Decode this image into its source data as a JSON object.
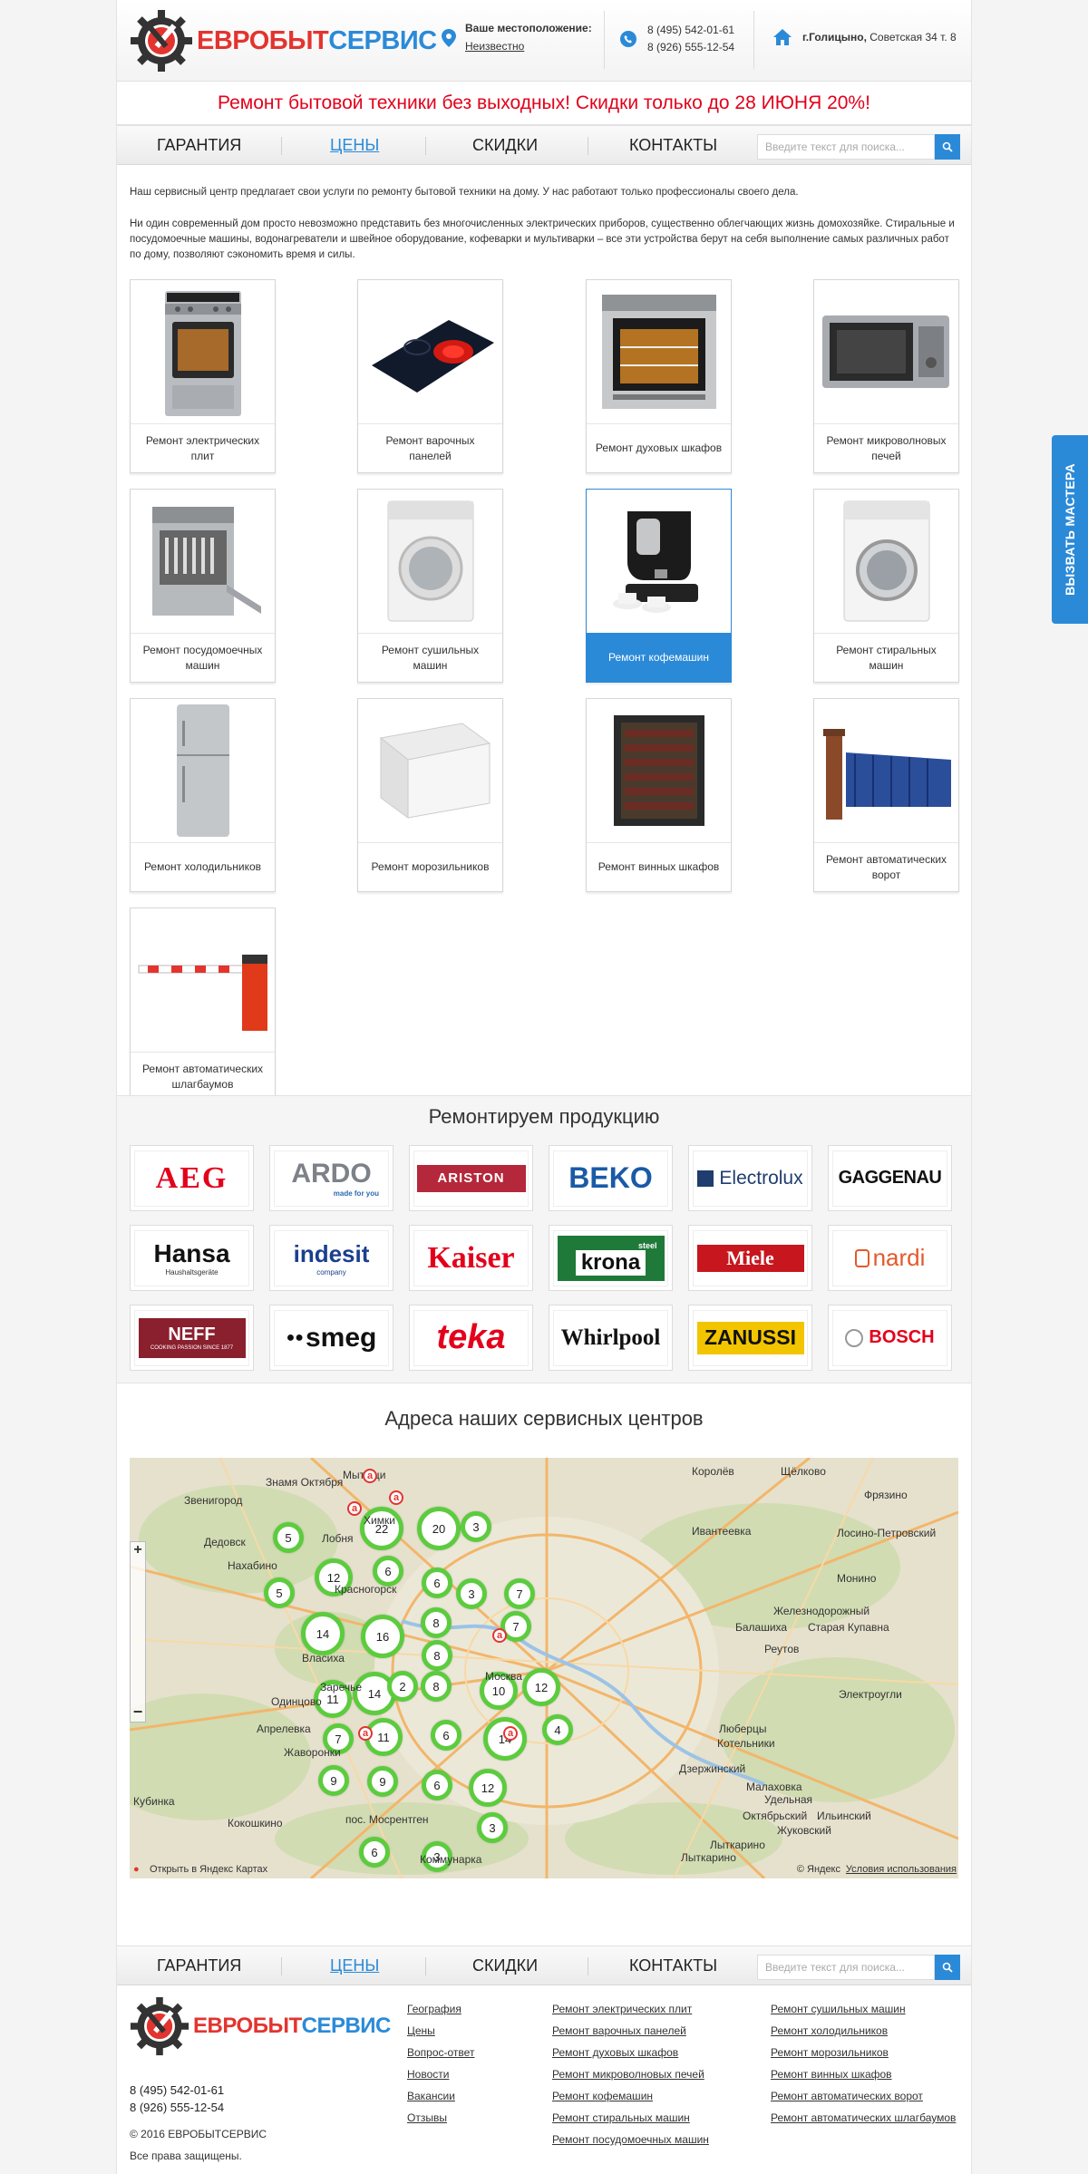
{
  "header": {
    "logo_red": "ЕВРОБЫТ",
    "logo_blue": "СЕРВИС",
    "location_title": "Ваше местоположение:",
    "location_value": "Неизвестно",
    "phone1": "8 (495) 542-01-61",
    "phone2": "8 (926) 555-12-54",
    "address_city": "г.Голицыно,",
    "address_street": " Советская 34 т. 8"
  },
  "promo": "Ремонт бытовой техники без выходных! Скидки только до 28 ИЮНЯ 20%!",
  "nav": {
    "items": [
      "ГАРАНТИЯ",
      "ЦЕНЫ",
      "СКИДКИ",
      "КОНТАКТЫ"
    ],
    "search_placeholder": "Введите текст для поиска..."
  },
  "intro": {
    "p1": "Наш сервисный центр предлагает свои услуги по ремонту бытовой техники на дому. У нас работают только профессионалы своего дела.",
    "p2": "Ни один современный дом просто невозможно представить без многочисленных электрических приборов, существенно облегчающих жизнь домохозяйке. Стиральные и посудомоечные машины, водонагреватели и швейное оборудование, кофеварки и мультиварки – все эти устройства берут на себя выполнение самых различных работ по дому, позволяют сэкономить время и силы."
  },
  "services": [
    {
      "label": "Ремонт электрических плит",
      "icon": "electric-stove"
    },
    {
      "label": "Ремонт варочных панелей",
      "icon": "cooktop"
    },
    {
      "label": "Ремонт духовых шкафов",
      "icon": "oven"
    },
    {
      "label": "Ремонт микроволновых печей",
      "icon": "microwave"
    },
    {
      "label": "Ремонт посудомоечных машин",
      "icon": "dishwasher"
    },
    {
      "label": "Ремонт сушильных машин",
      "icon": "dryer"
    },
    {
      "label": "Ремонт кофемашин",
      "icon": "coffee-machine"
    },
    {
      "label": "Ремонт стиральных машин",
      "icon": "washing-machine"
    },
    {
      "label": "Ремонт холодильников",
      "icon": "fridge"
    },
    {
      "label": "Ремонт морозильников",
      "icon": "freezer"
    },
    {
      "label": "Ремонт винных шкафов",
      "icon": "wine-cabinet"
    },
    {
      "label": "Ремонт автоматических ворот",
      "icon": "gate"
    },
    {
      "label": "Ремонт автоматических шлагбаумов",
      "icon": "barrier"
    }
  ],
  "brands_title": "Ремонтируем продукцию",
  "brands": [
    "AEG",
    "ARDO",
    "ARISTON",
    "BEKO",
    "Electrolux",
    "GAGGENAU",
    "Hansa",
    "indesit",
    "Kaiser",
    "krona",
    "Miele",
    "nardi",
    "NEFF",
    "smeg",
    "teka",
    "Whirlpool",
    "ZANUSSI",
    "BOSCH"
  ],
  "brand_sublines": {
    "ARDO": "made for you",
    "Hansa": "Haushaltsgeräte",
    "indesit": "company",
    "krona": "steel",
    "NEFF": "COOKING PASSION SINCE 1877"
  },
  "map": {
    "title": "Адреса наших сервисных центров",
    "clusters": [
      5,
      22,
      20,
      3,
      12,
      6,
      6,
      3,
      7,
      5,
      8,
      7,
      14,
      16,
      8,
      14,
      11,
      2,
      8,
      10,
      12,
      7,
      11,
      6,
      14,
      4,
      9,
      9,
      6,
      12,
      3,
      6,
      3
    ],
    "place_labels": [
      "Королёв",
      "Щёлково",
      "Мытищи",
      "Дедовск",
      "Нахабино",
      "Красногорск",
      "Балашиха",
      "Реутов",
      "Москва",
      "Одинцово",
      "Котельники",
      "Дзержинский",
      "Лыткарино",
      "Жуковский",
      "Люберцы",
      "Малаховка",
      "Старая Купавна",
      "Лосино-Петровский",
      "Монино",
      "Электроугли",
      "Ильинский",
      "Октябрьский",
      "Заречье",
      "Кокошкино",
      "Коммунарка",
      "пос. Мосрентген",
      "Звенигород",
      "Химки",
      "Железнодорожный",
      "Фрязино",
      "Лобня",
      "Ивантеевка",
      "Апрелевка",
      "Удельная",
      "Кубинка",
      "Жаворонки",
      "Власиха",
      "Знамя Октября",
      "Лыткарино"
    ],
    "open_link": "Открыть в Яндекс Картах",
    "copyright": "© Яндекс",
    "terms": "Условия использования"
  },
  "footer": {
    "nav_items": [
      "ГАРАНТИЯ",
      "ЦЕНЫ",
      "СКИДКИ",
      "КОНТАКТЫ"
    ],
    "search_placeholder": "Введите текст для поиска...",
    "phone1": "8 (495) 542-01-61",
    "phone2": "8 (926) 555-12-54",
    "copyright": "© 2016 ЕВРОБЫТСЕРВИС",
    "rights": "Все права защищены.",
    "col1": [
      "География",
      "Цены",
      "Вопрос-ответ",
      "Новости",
      "Вакансии",
      "Отзывы"
    ],
    "col2": [
      "Ремонт электрических плит",
      "Ремонт варочных панелей",
      "Ремонт духовых шкафов",
      "Ремонт микроволновых печей",
      "Ремонт кофемашин",
      "Ремонт стиральных машин",
      "Ремонт посудомоечных машин"
    ],
    "col3": [
      "Ремонт сушильных машин",
      "Ремонт холодильников",
      "Ремонт морозильников",
      "Ремонт винных шкафов",
      "Ремонт автоматических ворот",
      "Ремонт автоматических шлагбаумов"
    ]
  },
  "side_tab": "ВЫЗВАТЬ МАСТЕРА",
  "colors": {
    "brand_red": "#e3342f",
    "brand_blue": "#2b8ad8",
    "promo_red": "#e3001b",
    "cluster_green": "#5ccc3e"
  }
}
